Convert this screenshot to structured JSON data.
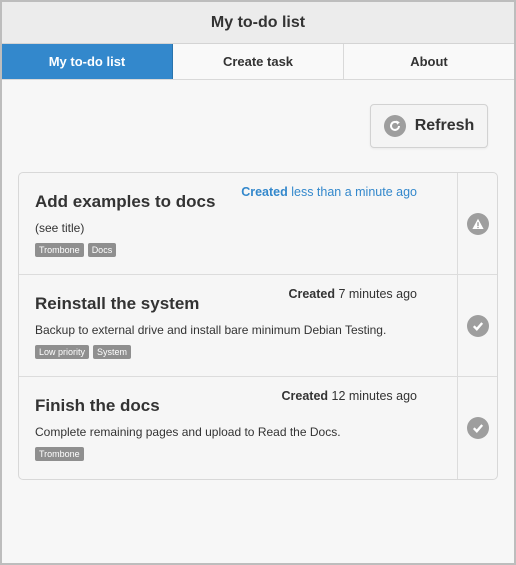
{
  "header": {
    "title": "My to-do list"
  },
  "tabs": [
    {
      "label": "My to-do list",
      "active": true
    },
    {
      "label": "Create task",
      "active": false
    },
    {
      "label": "About",
      "active": false
    }
  ],
  "toolbar": {
    "refresh_label": "Refresh",
    "refresh_icon": "refresh-icon"
  },
  "tasks": [
    {
      "title": "Add examples to docs",
      "description": "(see title)",
      "created_label": "Created",
      "created_when": "less than a minute ago",
      "tags": [
        "Trombone",
        "Docs"
      ],
      "status_icon": "alert-icon"
    },
    {
      "title": "Reinstall the system",
      "description": "Backup to external drive and install bare minimum Debian Testing.",
      "created_label": "Created",
      "created_when": "7 minutes ago",
      "tags": [
        "Low priority",
        "System"
      ],
      "status_icon": "check-icon"
    },
    {
      "title": "Finish the docs",
      "description": "Complete remaining pages and upload to Read the Docs.",
      "created_label": "Created",
      "created_when": "12 minutes ago",
      "tags": [
        "Trombone"
      ],
      "status_icon": "check-icon"
    }
  ],
  "colors": {
    "accent": "#3388cc",
    "tag_bg": "#8f8f8f",
    "icon_bg": "#9e9e9e"
  }
}
